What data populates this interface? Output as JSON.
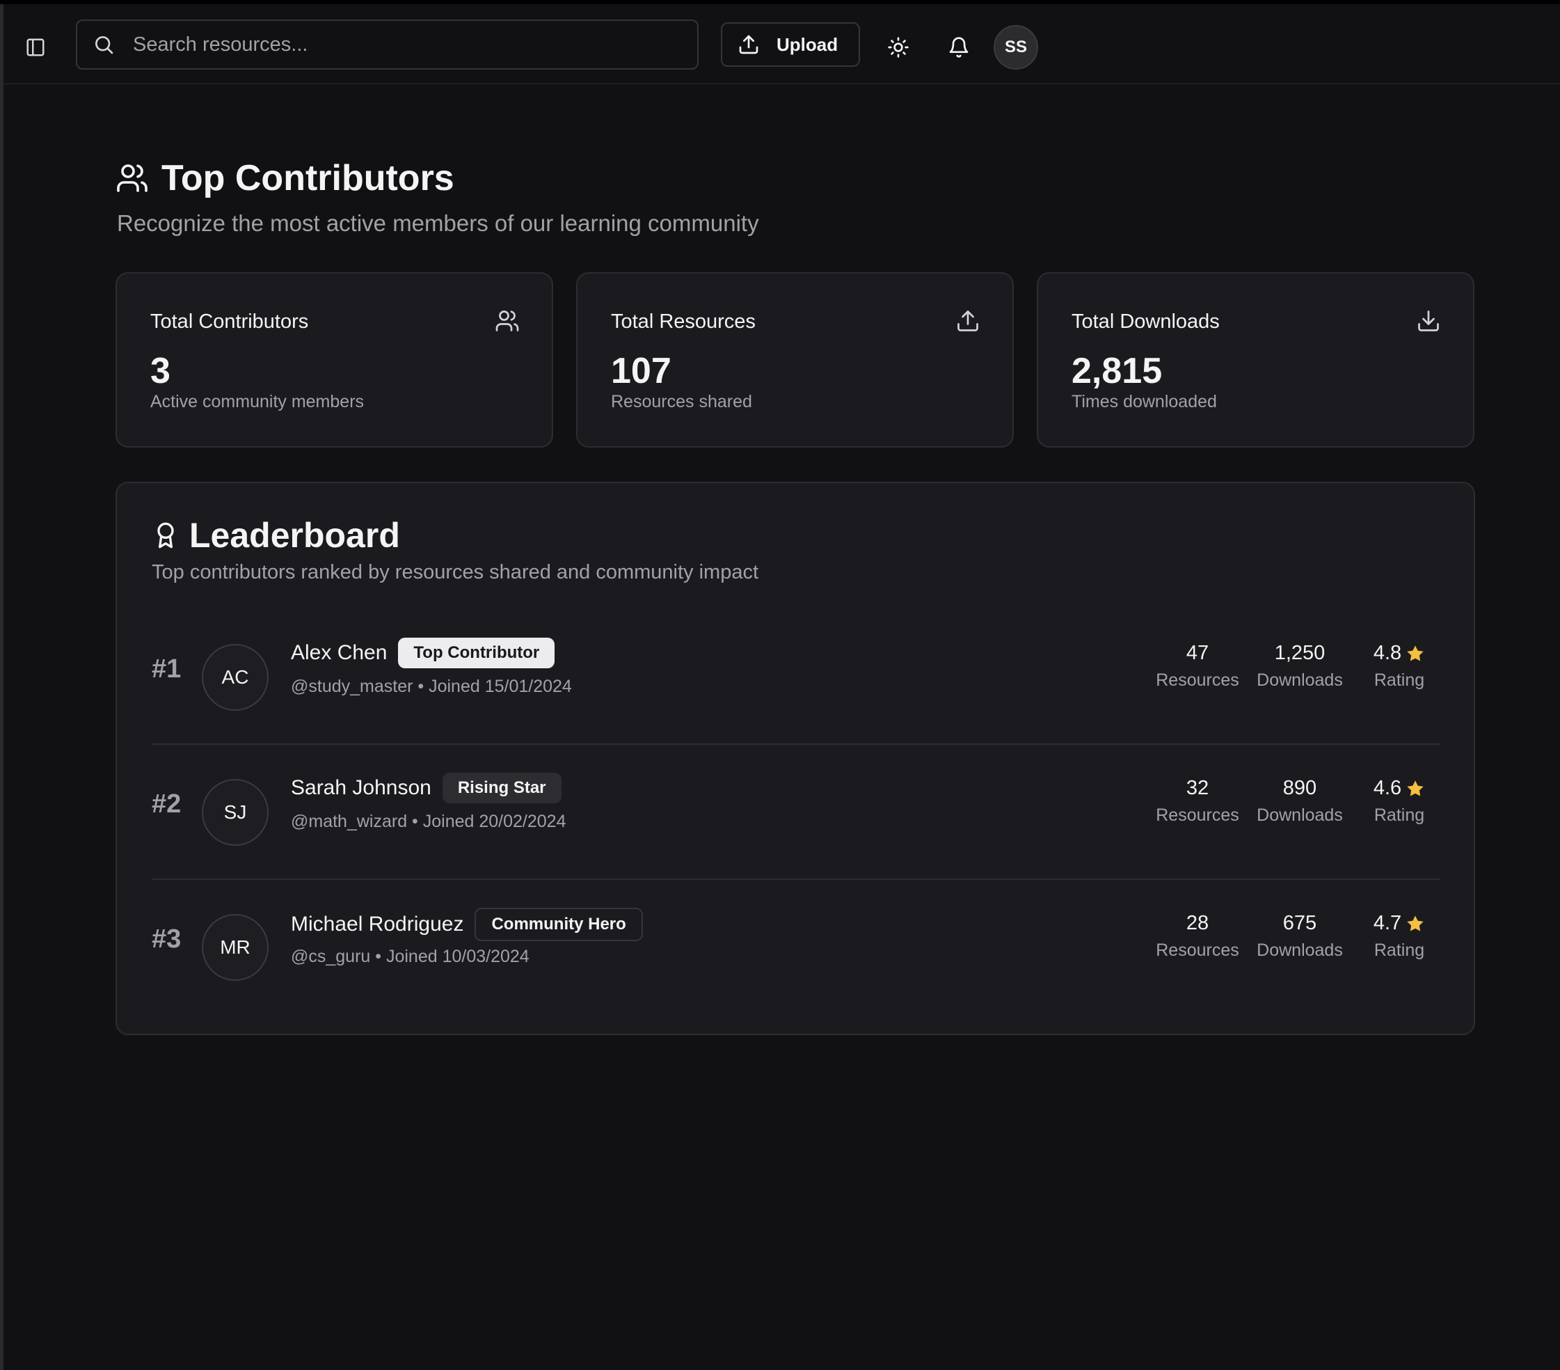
{
  "header": {
    "search_placeholder": "Search resources...",
    "upload_label": "Upload",
    "user_initials": "SS"
  },
  "page": {
    "title": "Top Contributors",
    "subtitle": "Recognize the most active members of our learning community"
  },
  "stats": [
    {
      "label": "Total Contributors",
      "value": "3",
      "desc": "Active community members",
      "icon": "users-icon"
    },
    {
      "label": "Total Resources",
      "value": "107",
      "desc": "Resources shared",
      "icon": "upload-icon"
    },
    {
      "label": "Total Downloads",
      "value": "2,815",
      "desc": "Times downloaded",
      "icon": "download-icon"
    }
  ],
  "leaderboard": {
    "title": "Leaderboard",
    "subtitle": "Top contributors ranked by resources shared and community impact",
    "stat_labels": {
      "resources": "Resources",
      "downloads": "Downloads",
      "rating": "Rating"
    },
    "rows": [
      {
        "rank": "#1",
        "initials": "AC",
        "name": "Alex Chen",
        "badge": "Top Contributor",
        "meta": "@study_master • Joined 15/01/2024",
        "resources": "47",
        "downloads": "1,250",
        "rating": "4.8"
      },
      {
        "rank": "#2",
        "initials": "SJ",
        "name": "Sarah Johnson",
        "badge": "Rising Star",
        "meta": "@math_wizard • Joined 20/02/2024",
        "resources": "32",
        "downloads": "890",
        "rating": "4.6"
      },
      {
        "rank": "#3",
        "initials": "MR",
        "name": "Michael Rodriguez",
        "badge": "Community Hero",
        "meta": "@cs_guru • Joined 10/03/2024",
        "resources": "28",
        "downloads": "675",
        "rating": "4.7"
      }
    ]
  },
  "colors": {
    "background": "#111113",
    "card": "#1b1b1f",
    "star": "#f5c042",
    "muted_text": "#a1a1aa"
  }
}
